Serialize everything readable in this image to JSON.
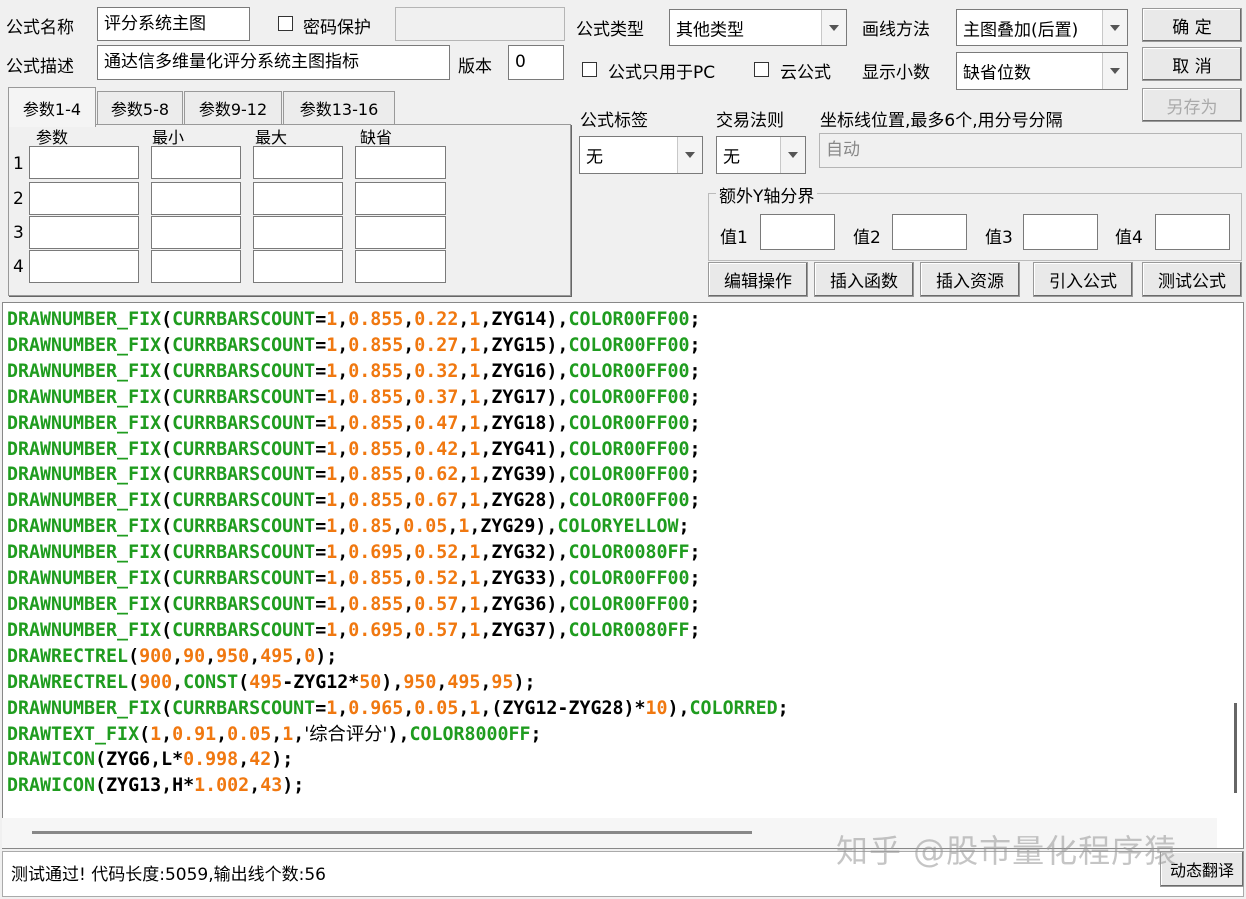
{
  "form": {
    "name_label": "公式名称",
    "name_value": "评分系统主图",
    "password_label": "密码保护",
    "password_value": "",
    "desc_label": "公式描述",
    "desc_value": "通达信多维量化评分系统主图指标",
    "version_label": "版本",
    "version_value": "0",
    "type_label": "公式类型",
    "type_value": "其他类型",
    "draw_label": "画线方法",
    "draw_value": "主图叠加(后置)",
    "pc_only_label": "公式只用于PC",
    "cloud_label": "云公式",
    "decimals_label": "显示小数",
    "decimals_value": "缺省位数",
    "tag_label": "公式标签",
    "tag_value": "无",
    "trade_label": "交易法则",
    "trade_value": "无",
    "axis_label": "坐标线位置,最多6个,用分号分隔",
    "axis_value": "自动",
    "extra_y_label": "额外Y轴分界",
    "y_values": [
      {
        "label": "值1",
        "value": ""
      },
      {
        "label": "值2",
        "value": ""
      },
      {
        "label": "值3",
        "value": ""
      },
      {
        "label": "值4",
        "value": ""
      }
    ]
  },
  "buttons": {
    "ok": "确  定",
    "cancel": "取  消",
    "save_as": "另存为",
    "edit": "编辑操作",
    "insert_func": "插入函数",
    "insert_res": "插入资源",
    "import": "引入公式",
    "test": "测试公式",
    "translate": "动态翻译"
  },
  "tabs": [
    "参数1-4",
    "参数5-8",
    "参数9-12",
    "参数13-16"
  ],
  "params": {
    "headers": [
      "参数",
      "最小",
      "最大",
      "缺省"
    ],
    "rows": [
      "1",
      "2",
      "3",
      "4"
    ]
  },
  "code_lines": [
    "DRAWNUMBER_FIX(CURRBARSCOUNT=1,0.855,0.22,1,ZYG14),COLOR00FF00;",
    "DRAWNUMBER_FIX(CURRBARSCOUNT=1,0.855,0.27,1,ZYG15),COLOR00FF00;",
    "DRAWNUMBER_FIX(CURRBARSCOUNT=1,0.855,0.32,1,ZYG16),COLOR00FF00;",
    "DRAWNUMBER_FIX(CURRBARSCOUNT=1,0.855,0.37,1,ZYG17),COLOR00FF00;",
    "DRAWNUMBER_FIX(CURRBARSCOUNT=1,0.855,0.47,1,ZYG18),COLOR00FF00;",
    "DRAWNUMBER_FIX(CURRBARSCOUNT=1,0.855,0.42,1,ZYG41),COLOR00FF00;",
    "DRAWNUMBER_FIX(CURRBARSCOUNT=1,0.855,0.62,1,ZYG39),COLOR00FF00;",
    "DRAWNUMBER_FIX(CURRBARSCOUNT=1,0.855,0.67,1,ZYG28),COLOR00FF00;",
    "DRAWNUMBER_FIX(CURRBARSCOUNT=1,0.85,0.05,1,ZYG29),COLORYELLOW;",
    "DRAWNUMBER_FIX(CURRBARSCOUNT=1,0.695,0.52,1,ZYG32),COLOR0080FF;",
    "DRAWNUMBER_FIX(CURRBARSCOUNT=1,0.855,0.52,1,ZYG33),COLOR00FF00;",
    "DRAWNUMBER_FIX(CURRBARSCOUNT=1,0.855,0.57,1,ZYG36),COLOR00FF00;",
    "DRAWNUMBER_FIX(CURRBARSCOUNT=1,0.695,0.57,1,ZYG37),COLOR0080FF;",
    "DRAWRECTREL(900,90,950,495,0);",
    "DRAWRECTREL(900,CONST(495-ZYG12*50),950,495,95);",
    "DRAWNUMBER_FIX(CURRBARSCOUNT=1,0.965,0.05,1,(ZYG12-ZYG28)*10),COLORRED;",
    "DRAWTEXT_FIX(1,0.91,0.05,1,'综合评分'),COLOR8000FF;",
    "DRAWICON(ZYG6,L*0.998,42);",
    "DRAWICON(ZYG13,H*1.002,43);"
  ],
  "status": "测试通过! 代码长度:5059,输出线个数:56",
  "watermark": "知乎 @股市量化程序猿",
  "colors": {
    "keyword": "#1f9c1f",
    "number": "#f07810",
    "plain": "#000000"
  }
}
